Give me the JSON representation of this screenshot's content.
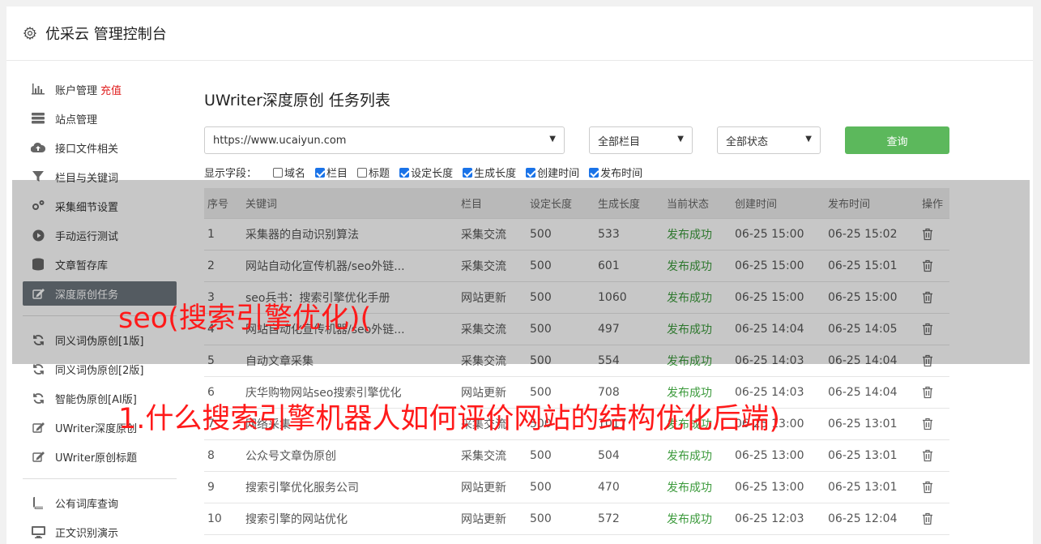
{
  "header": {
    "title": "优采云 管理控制台"
  },
  "sidebar": {
    "group1": [
      {
        "label": "账户管理",
        "extra": "充值",
        "icon": "bar-chart-icon"
      },
      {
        "label": "站点管理",
        "icon": "server-icon"
      },
      {
        "label": "接口文件相关",
        "icon": "cloud-upload-icon"
      },
      {
        "label": "栏目与关键词",
        "icon": "filter-icon"
      },
      {
        "label": "采集细节设置",
        "icon": "gears-icon"
      },
      {
        "label": "手动运行测试",
        "icon": "play-icon"
      },
      {
        "label": "文章暂存库",
        "icon": "database-icon"
      },
      {
        "label": "深度原创任务",
        "icon": "edit-icon",
        "active": true
      }
    ],
    "group2": [
      {
        "label": "同义词伪原创[1版]",
        "icon": "refresh-icon"
      },
      {
        "label": "同义词伪原创[2版]",
        "icon": "refresh-icon"
      },
      {
        "label": "智能伪原创[AI版]",
        "icon": "refresh-icon"
      },
      {
        "label": "UWriter深度原创",
        "icon": "edit-icon"
      },
      {
        "label": "UWriter原创标题",
        "icon": "edit-icon"
      }
    ],
    "group3": [
      {
        "label": "公有词库查询",
        "icon": "book-icon"
      },
      {
        "label": "正文识别演示",
        "icon": "monitor-icon"
      }
    ]
  },
  "main": {
    "title": "UWriter深度原创 任务列表",
    "site_select": "https://www.ucaiyun.com",
    "column_select": "全部栏目",
    "status_select": "全部状态",
    "query_label": "查询",
    "fields_label": "显示字段：",
    "fields": [
      {
        "label": "域名",
        "checked": false
      },
      {
        "label": "栏目",
        "checked": true
      },
      {
        "label": "标题",
        "checked": false
      },
      {
        "label": "设定长度",
        "checked": true
      },
      {
        "label": "生成长度",
        "checked": true
      },
      {
        "label": "创建时间",
        "checked": true
      },
      {
        "label": "发布时间",
        "checked": true
      }
    ]
  },
  "table": {
    "headers": [
      "序号",
      "关键词",
      "栏目",
      "设定长度",
      "生成长度",
      "当前状态",
      "创建时间",
      "发布时间",
      "操作"
    ],
    "rows": [
      [
        "1",
        "采集器的自动识别算法",
        "采集交流",
        "500",
        "533",
        "发布成功",
        "06-25 15:00",
        "06-25 15:02"
      ],
      [
        "2",
        "网站自动化宣传机器/seo外链...",
        "采集交流",
        "500",
        "601",
        "发布成功",
        "06-25 15:00",
        "06-25 15:01"
      ],
      [
        "3",
        "seo兵书：搜索引擎优化手册",
        "网站更新",
        "500",
        "1060",
        "发布成功",
        "06-25 15:00",
        "06-25 15:00"
      ],
      [
        "4",
        "网站自动化宣传机器/seo外链...",
        "采集交流",
        "500",
        "497",
        "发布成功",
        "06-25 14:04",
        "06-25 14:05"
      ],
      [
        "5",
        "自动文章采集",
        "采集交流",
        "500",
        "554",
        "发布成功",
        "06-25 14:03",
        "06-25 14:04"
      ],
      [
        "6",
        "庆华购物网站seo搜索引擎优化",
        "网站更新",
        "500",
        "708",
        "发布成功",
        "06-25 14:03",
        "06-25 14:04"
      ],
      [
        "7",
        "网络采集",
        "采集交流",
        "500",
        "1017",
        "发布成功",
        "06-25 13:00",
        "06-25 13:01"
      ],
      [
        "8",
        "公众号文章伪原创",
        "采集交流",
        "500",
        "504",
        "发布成功",
        "06-25 13:00",
        "06-25 13:01"
      ],
      [
        "9",
        "搜索引擎优化服务公司",
        "网站更新",
        "500",
        "470",
        "发布成功",
        "06-25 13:00",
        "06-25 13:01"
      ],
      [
        "10",
        "搜索引擎的网站优化",
        "网站更新",
        "500",
        "572",
        "发布成功",
        "06-25 12:03",
        "06-25 12:04"
      ]
    ]
  },
  "watermark": {
    "line1": "seo(搜索引擎优化)(",
    "line2": "1.什么搜索引擎机器人如何评价网站的结构优化后端)"
  }
}
